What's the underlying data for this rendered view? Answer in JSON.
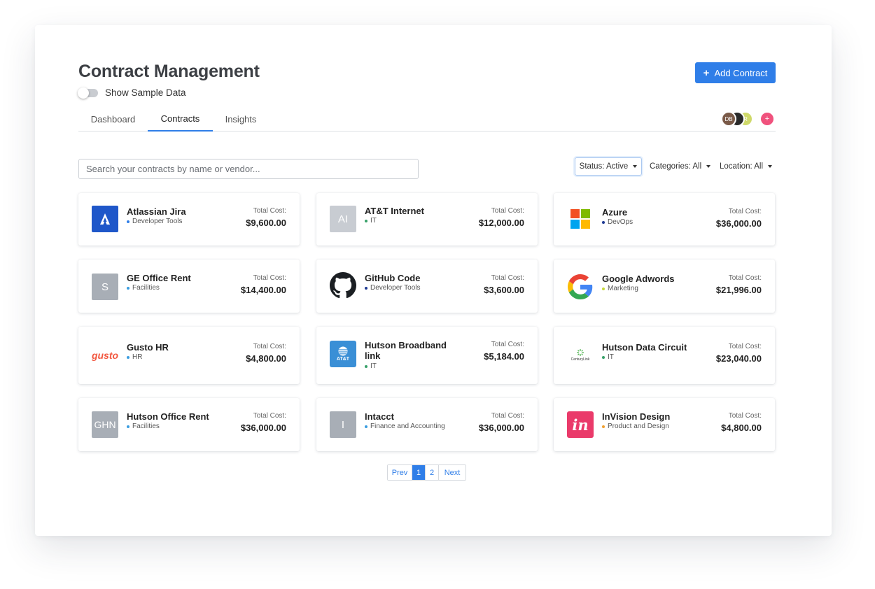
{
  "header": {
    "title": "Contract Management",
    "toggle_label": "Show Sample Data",
    "add_button_label": "Add Contract"
  },
  "tabs": [
    {
      "label": "Dashboard",
      "active": false
    },
    {
      "label": "Contracts",
      "active": true
    },
    {
      "label": "Insights",
      "active": false
    }
  ],
  "avatars": [
    {
      "initials": "DB"
    },
    {
      "initials": ""
    },
    {
      "initials": "R"
    },
    {
      "initials": "+"
    }
  ],
  "search": {
    "placeholder": "Search your contracts by name or vendor..."
  },
  "filters": {
    "status": "Status: Active",
    "categories": "Categories: All",
    "location": "Location: All"
  },
  "cost_label": "Total Cost:",
  "contracts": [
    {
      "name": "Atlassian Jira",
      "category": "Developer Tools",
      "cost": "$9,600.00",
      "logo": "atlassian-logo",
      "dot_color": "#2f7ee8"
    },
    {
      "name": "AT&T Internet",
      "category": "IT",
      "cost": "$12,000.00",
      "logo": "initials-AI",
      "initials": "AI",
      "dot_color": "#38a169"
    },
    {
      "name": "Azure",
      "category": "DevOps",
      "cost": "$36,000.00",
      "logo": "microsoft-logo",
      "dot_color": "#1f3a93"
    },
    {
      "name": "GE Office Rent",
      "category": "Facilities",
      "cost": "$14,400.00",
      "logo": "initials-S",
      "initials": "S",
      "dot_color": "#3b9de0"
    },
    {
      "name": "GitHub Code",
      "category": "Developer Tools",
      "cost": "$3,600.00",
      "logo": "github-logo",
      "dot_color": "#1f3a93"
    },
    {
      "name": "Google Adwords",
      "category": "Marketing",
      "cost": "$21,996.00",
      "logo": "google-logo",
      "dot_color": "#c7d83a"
    },
    {
      "name": "Gusto HR",
      "category": "HR",
      "cost": "$4,800.00",
      "logo": "gusto-logo",
      "logo_text": "gusto",
      "dot_color": "#3b9de0"
    },
    {
      "name": "Hutson Broadband link",
      "category": "IT",
      "cost": "$5,184.00",
      "logo": "att-logo",
      "logo_text": "AT&T",
      "dot_color": "#38a169"
    },
    {
      "name": "Hutson Data Circuit",
      "category": "IT",
      "cost": "$23,040.00",
      "logo": "centurylink-logo",
      "logo_text": "CenturyLink",
      "dot_color": "#38a169"
    },
    {
      "name": "Hutson Office Rent",
      "category": "Facilities",
      "cost": "$36,000.00",
      "logo": "initials-GHN",
      "initials": "GHN",
      "dot_color": "#3b9de0"
    },
    {
      "name": "Intacct",
      "category": "Finance and Accounting",
      "cost": "$36,000.00",
      "logo": "initials-I",
      "initials": "I",
      "dot_color": "#3b9de0"
    },
    {
      "name": "InVision Design",
      "category": "Product and Design",
      "cost": "$4,800.00",
      "logo": "invision-logo",
      "logo_text": "in",
      "dot_color": "#f0a030"
    }
  ],
  "pagination": {
    "prev": "Prev",
    "pages": [
      "1",
      "2"
    ],
    "current": "1",
    "next": "Next"
  },
  "colors": {
    "accent": "#2f7ee8",
    "avatar_add": "#f0527d"
  }
}
